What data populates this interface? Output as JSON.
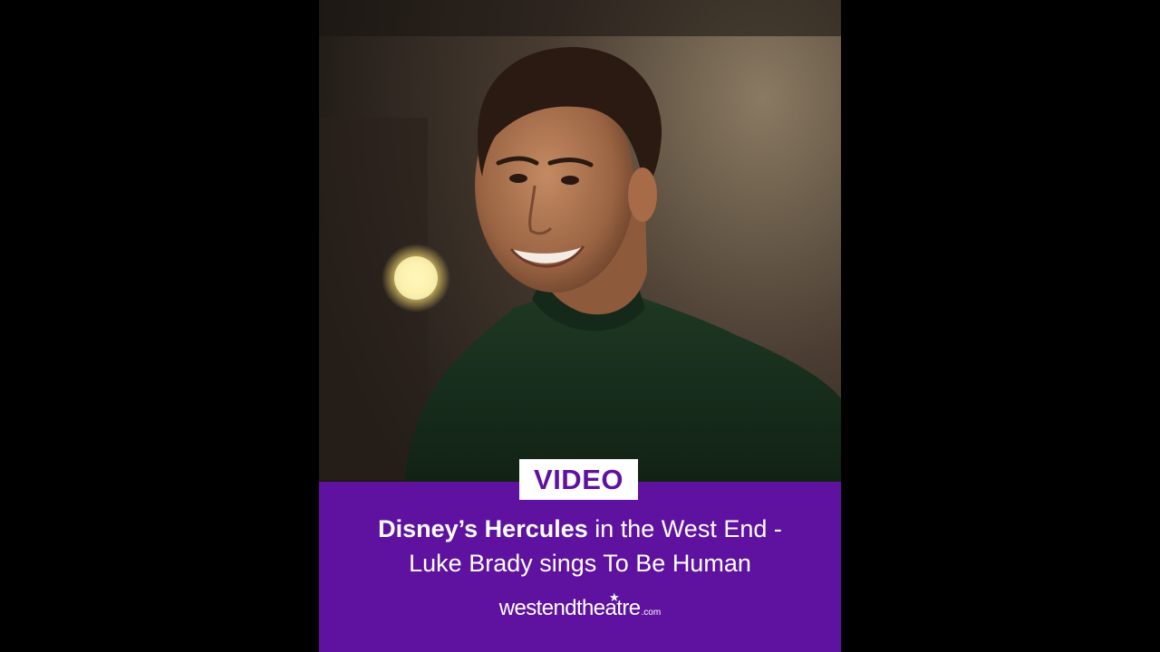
{
  "badge": {
    "label": "VIDEO"
  },
  "title": {
    "line1_bold": "Disney’s Hercules",
    "line1_rest": " in the West End -",
    "line2": "Luke Brady sings To Be Human"
  },
  "logo": {
    "name": "westendtheatre",
    "tld": ".com",
    "star_icon": "star-icon"
  },
  "colors": {
    "brand_purple": "#5f12a0",
    "letterbox": "#000000",
    "text": "#ffffff"
  }
}
